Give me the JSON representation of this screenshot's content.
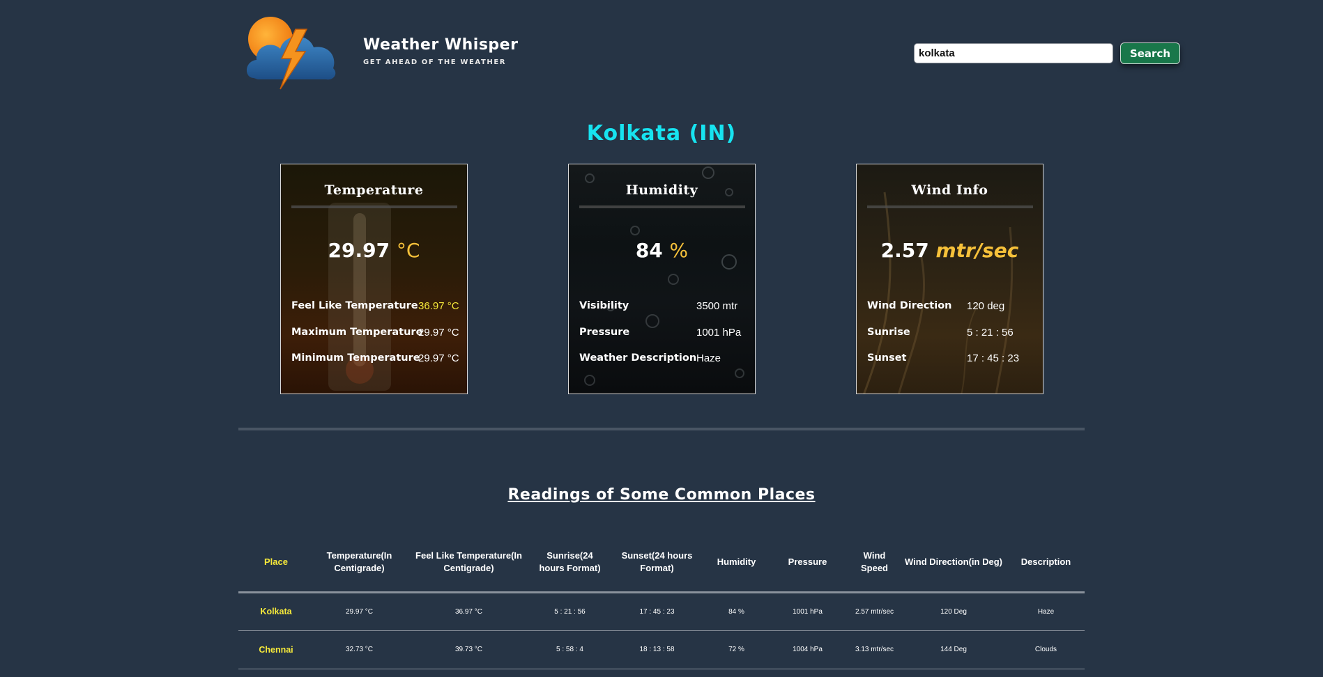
{
  "header": {
    "logo_icon": "storm-cloud-logo-icon",
    "brand_title": "Weather Whisper",
    "brand_tagline": "GET AHEAD OF THE WEATHER",
    "search_value": "kolkata",
    "search_button_label": "Search"
  },
  "city": {
    "title": "Kolkata (IN)"
  },
  "cards": {
    "temperature": {
      "heading": "Temperature",
      "main_value": "29.97",
      "main_unit": "°C",
      "rows": [
        {
          "label": "Feel Like Temperature",
          "value": "36.97 °C"
        },
        {
          "label": "Maximum Temperature",
          "value": "29.97 °C"
        },
        {
          "label": "Minimum Temperature",
          "value": "29.97 °C"
        }
      ]
    },
    "humidity": {
      "heading": "Humidity",
      "main_value": "84",
      "main_unit": "%",
      "rows": [
        {
          "label": "Visibility",
          "value": "3500 mtr"
        },
        {
          "label": "Pressure",
          "value": "1001 hPa"
        },
        {
          "label": "Weather Description",
          "value": "Haze"
        }
      ]
    },
    "wind": {
      "heading": "Wind Info",
      "main_value": "2.57",
      "main_unit": "mtr/sec",
      "rows": [
        {
          "label": "Wind Direction",
          "value": "120 deg"
        },
        {
          "label": "Sunrise",
          "value": "5 : 21 : 56"
        },
        {
          "label": "Sunset",
          "value": "17 : 45 : 23"
        }
      ]
    }
  },
  "readings": {
    "title": "Readings of Some Common Places",
    "columns": [
      "Place",
      "Temperature(In Centigrade)",
      "Feel Like Temperature(In Centigrade)",
      "Sunrise(24 hours Format)",
      "Sunset(24 hours Format)",
      "Humidity",
      "Pressure",
      "Wind Speed",
      "Wind Direction(in Deg)",
      "Description"
    ],
    "rows": [
      [
        "Kolkata",
        "29.97 °C",
        "36.97 °C",
        "5 : 21 : 56",
        "17 : 45 : 23",
        "84 %",
        "1001 hPa",
        "2.57 mtr/sec",
        "120 Deg",
        "Haze"
      ],
      [
        "Chennai",
        "32.73 °C",
        "39.73 °C",
        "5 : 58 : 4",
        "18 : 13 : 58",
        "72 %",
        "1004 hPa",
        "3.13 mtr/sec",
        "144 Deg",
        "Clouds"
      ]
    ]
  },
  "colors": {
    "background": "#263445",
    "city_title": "#17e3f0",
    "accent_yellow": "#f6e93a",
    "unit_gold": "#f6c13a",
    "search_button": "#19774a"
  }
}
